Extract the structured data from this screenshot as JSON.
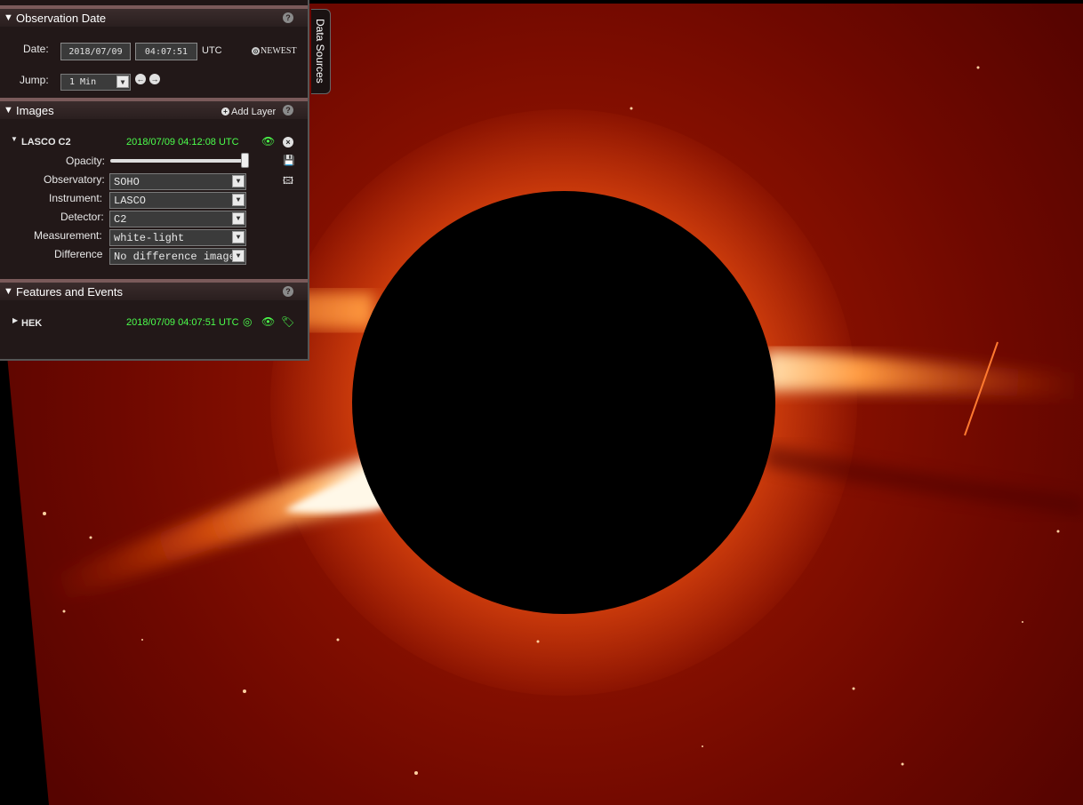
{
  "observation": {
    "title": "Observation Date",
    "date_label": "Date:",
    "date_value": "2018/07/09",
    "time_value": "04:07:51",
    "tz": "UTC",
    "newest": "NEWEST",
    "jump_label": "Jump:",
    "jump_value": "1 Min"
  },
  "images": {
    "title": "Images",
    "add_layer": "Add Layer",
    "layer": {
      "name": "LASCO C2",
      "timestamp": "2018/07/09 04:12:08 UTC",
      "opacity_label": "Opacity:",
      "opacity_value": 1.0,
      "observatory_label": "Observatory:",
      "observatory_value": "SOHO",
      "instrument_label": "Instrument:",
      "instrument_value": "LASCO",
      "detector_label": "Detector:",
      "detector_value": "C2",
      "measurement_label": "Measurement:",
      "measurement_value": "white-light",
      "difference_label": "Difference",
      "difference_value": "No difference image"
    }
  },
  "features": {
    "title": "Features and Events",
    "hek_name": "HEK",
    "hek_timestamp": "2018/07/09 04:07:51 UTC"
  },
  "data_sources_tab": "Data Sources",
  "colors": {
    "panel_bg": "#221818",
    "accent_green": "#4cff4c",
    "corona_red": "#8a0d00"
  }
}
